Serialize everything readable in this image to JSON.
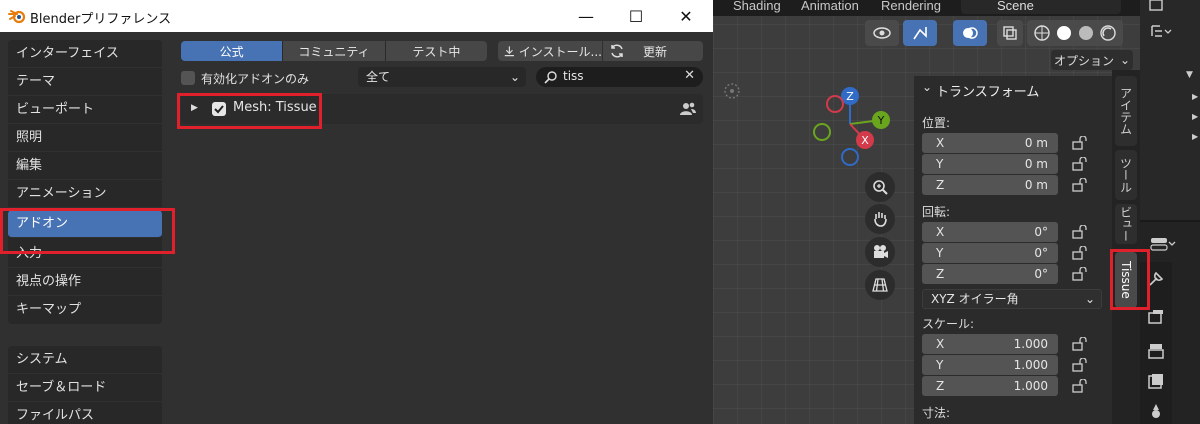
{
  "window": {
    "title": "Blenderプリファレンス",
    "minimize": "—",
    "maximize": "☐",
    "close": "✕"
  },
  "sidebar": {
    "group1": [
      {
        "label": "インターフェイス"
      },
      {
        "label": "テーマ"
      },
      {
        "label": "ビューポート"
      },
      {
        "label": "照明"
      },
      {
        "label": "編集"
      },
      {
        "label": "アニメーション"
      },
      {
        "label": "アドオン",
        "active": true
      },
      {
        "label": "入力"
      },
      {
        "label": "視点の操作"
      },
      {
        "label": "キーマップ"
      }
    ],
    "group2": [
      {
        "label": "システム"
      },
      {
        "label": "セーブ＆ロード"
      },
      {
        "label": "ファイルパス"
      }
    ]
  },
  "addons": {
    "tabs": [
      "公式",
      "コミュニティ",
      "テスト中"
    ],
    "active_tab": "公式",
    "install_label": "インストール...",
    "refresh_label": "更新",
    "enabled_only_label": "有効化アドオンのみ",
    "category_value": "全て",
    "search_value": "tiss",
    "results": [
      {
        "name": "Mesh: Tissue",
        "enabled": true
      }
    ]
  },
  "viewport": {
    "workspace_tabs": [
      "Shading",
      "Animation",
      "Rendering"
    ],
    "scene_name": "Scene",
    "options_label": "オプション",
    "npanel": {
      "section_title": "トランスフォーム",
      "location_label": "位置:",
      "location": [
        {
          "axis": "X",
          "value": "0 m"
        },
        {
          "axis": "Y",
          "value": "0 m"
        },
        {
          "axis": "Z",
          "value": "0 m"
        }
      ],
      "rotation_label": "回転:",
      "rotation": [
        {
          "axis": "X",
          "value": "0°"
        },
        {
          "axis": "Y",
          "value": "0°"
        },
        {
          "axis": "Z",
          "value": "0°"
        }
      ],
      "rotation_mode": "XYZ オイラー角",
      "scale_label": "スケール:",
      "scale": [
        {
          "axis": "X",
          "value": "1.000"
        },
        {
          "axis": "Y",
          "value": "1.000"
        },
        {
          "axis": "Z",
          "value": "1.000"
        }
      ],
      "dimensions_label": "寸法:"
    },
    "vertical_tabs": [
      {
        "label": "アイテム"
      },
      {
        "label": "ツール"
      },
      {
        "label": "ビュー"
      },
      {
        "label": "Tissue",
        "active": true
      }
    ],
    "gizmo_labels": {
      "x": "X",
      "y": "Y",
      "z": "Z"
    }
  },
  "colors": {
    "accent": "#4772b3",
    "highlight": "#e0202a"
  }
}
